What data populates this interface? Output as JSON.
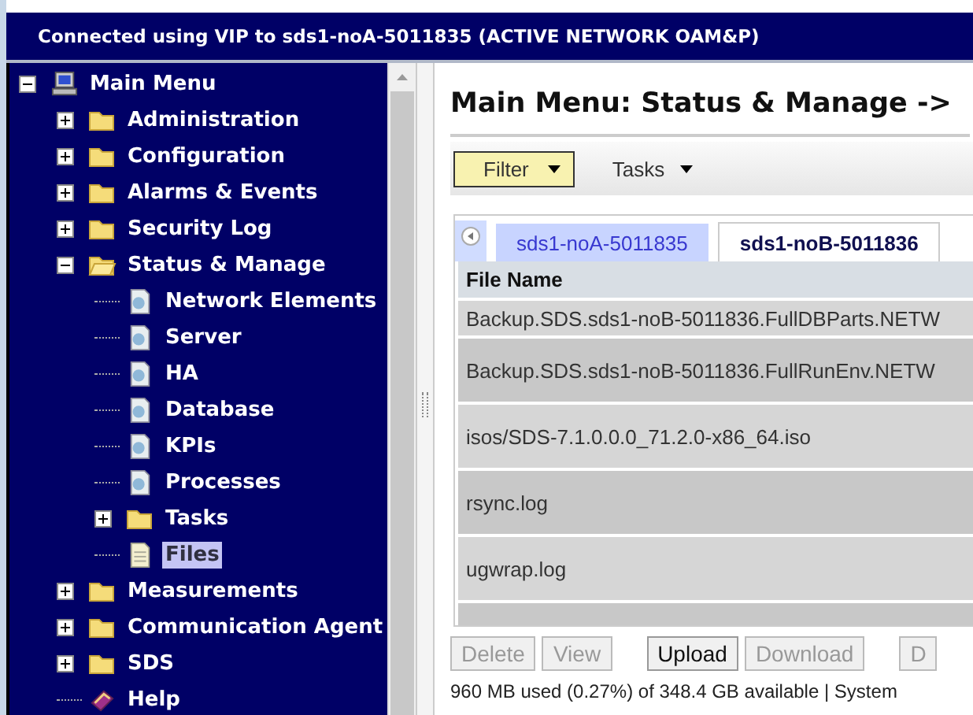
{
  "banner": {
    "title": "Connected using VIP to sds1-noA-5011835 (ACTIVE NETWORK OAM&P)"
  },
  "tree": [
    {
      "label": "Main Menu",
      "kind": "computer",
      "expanded": true,
      "selected": false,
      "children": [
        {
          "label": "Administration",
          "kind": "folder",
          "expanded": false,
          "selected": false
        },
        {
          "label": "Configuration",
          "kind": "folder",
          "expanded": false,
          "selected": false
        },
        {
          "label": "Alarms & Events",
          "kind": "folder",
          "expanded": false,
          "selected": false
        },
        {
          "label": "Security Log",
          "kind": "folder",
          "expanded": false,
          "selected": false
        },
        {
          "label": "Status & Manage",
          "kind": "folder",
          "expanded": true,
          "selected": false,
          "children": [
            {
              "label": "Network Elements",
              "kind": "page",
              "selected": false
            },
            {
              "label": "Server",
              "kind": "page",
              "selected": false
            },
            {
              "label": "HA",
              "kind": "page",
              "selected": false
            },
            {
              "label": "Database",
              "kind": "page",
              "selected": false
            },
            {
              "label": "KPIs",
              "kind": "page",
              "selected": false
            },
            {
              "label": "Processes",
              "kind": "page",
              "selected": false
            },
            {
              "label": "Tasks",
              "kind": "folder",
              "expanded": false,
              "selected": false
            },
            {
              "label": "Files",
              "kind": "file",
              "selected": true
            }
          ]
        },
        {
          "label": "Measurements",
          "kind": "folder",
          "expanded": false,
          "selected": false
        },
        {
          "label": "Communication Agent",
          "kind": "folder",
          "expanded": false,
          "selected": false
        },
        {
          "label": "SDS",
          "kind": "folder",
          "expanded": false,
          "selected": false
        },
        {
          "label": "Help",
          "kind": "book",
          "selected": false
        }
      ]
    }
  ],
  "heading": "Main Menu: Status & Manage ->",
  "toolbar": [
    {
      "label": "Filter",
      "kind": "button"
    },
    {
      "label": "Tasks",
      "kind": "menu"
    }
  ],
  "tabs": [
    {
      "label": "sds1-noA-5011835",
      "selected": false
    },
    {
      "label": "sds1-noB-5011836",
      "selected": true
    }
  ],
  "table": {
    "columns": [
      "File Name"
    ],
    "rows": [
      {
        "name": "Backup.SDS.sds1-noB-5011836.FullDBParts.NETW",
        "tall": false
      },
      {
        "name": "Backup.SDS.sds1-noB-5011836.FullRunEnv.NETW",
        "tall": true
      },
      {
        "name": "isos/SDS-7.1.0.0.0_71.2.0-x86_64.iso",
        "tall": true
      },
      {
        "name": "rsync.log",
        "tall": true
      },
      {
        "name": "ugwrap.log",
        "tall": true
      }
    ]
  },
  "actions": [
    {
      "label": "Delete",
      "disabled": true
    },
    {
      "label": "View",
      "disabled": true
    },
    {
      "label": "Upload",
      "disabled": false
    },
    {
      "label": "Download",
      "disabled": true
    },
    {
      "label": "D",
      "disabled": true
    }
  ],
  "status_bar": "960 MB used (0.27%) of 348.4 GB available | System"
}
